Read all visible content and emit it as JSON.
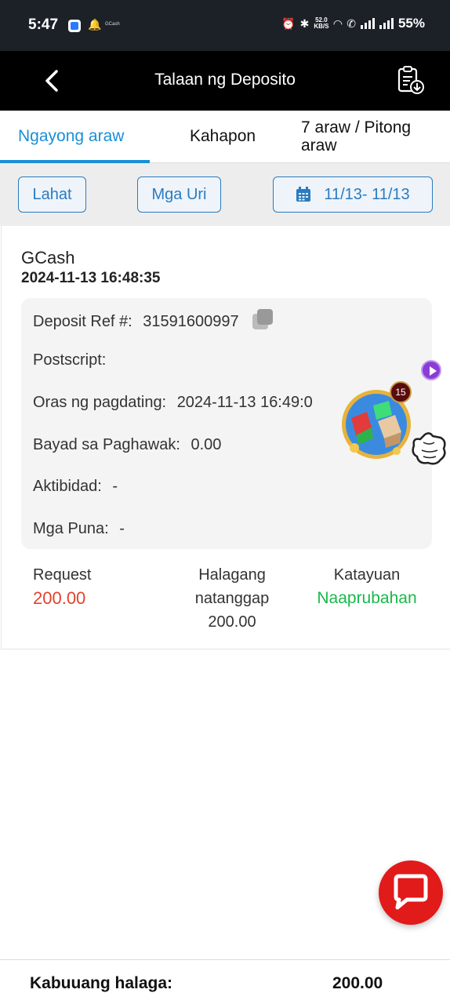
{
  "status_bar": {
    "time": "5:47",
    "notification_app": "GCash",
    "net_speed_value": "52.0",
    "net_speed_unit": "KB/S",
    "battery": "55%"
  },
  "header": {
    "title": "Talaan ng Deposito",
    "back_icon": "chevron-left-icon",
    "action_icon": "clipboard-download-icon"
  },
  "tabs": [
    {
      "label": "Ngayong araw",
      "active": true
    },
    {
      "label": "Kahapon",
      "active": false
    },
    {
      "label_line1": "7 araw / Pitong",
      "label_line2": "araw",
      "active": false
    }
  ],
  "filters": {
    "all_label": "Lahat",
    "types_label": "Mga Uri",
    "date_range": "11/13- 11/13"
  },
  "record": {
    "gateway": "GCash",
    "datetime": "2024-11-13 16:48:35",
    "details": {
      "ref_label": "Deposit Ref #:",
      "ref_value": "31591600997",
      "postscript_label": "Postscript:",
      "arrival_label": "Oras ng pagdating:",
      "arrival_value": "2024-11-13 16:49:0",
      "fee_label": "Bayad sa Paghawak:",
      "fee_value": "0.00",
      "activity_label": "Aktibidad:",
      "activity_value": "-",
      "remarks_label": "Mga Puna:",
      "remarks_value": "-"
    },
    "request_label": "Request",
    "request_value": "200.00",
    "received_label_line1": "Halagang",
    "received_label_line2": "natanggap",
    "received_value": "200.00",
    "status_label": "Katayuan",
    "status_value": "Naaprubahan"
  },
  "floating": {
    "badge_count": "15"
  },
  "footer": {
    "total_label": "Kabuuang halaga:",
    "total_value": "200.00"
  },
  "colors": {
    "accent": "#1a8fd6",
    "request": "#e5412d",
    "approved": "#19b84a",
    "chat": "#e11a1a"
  }
}
